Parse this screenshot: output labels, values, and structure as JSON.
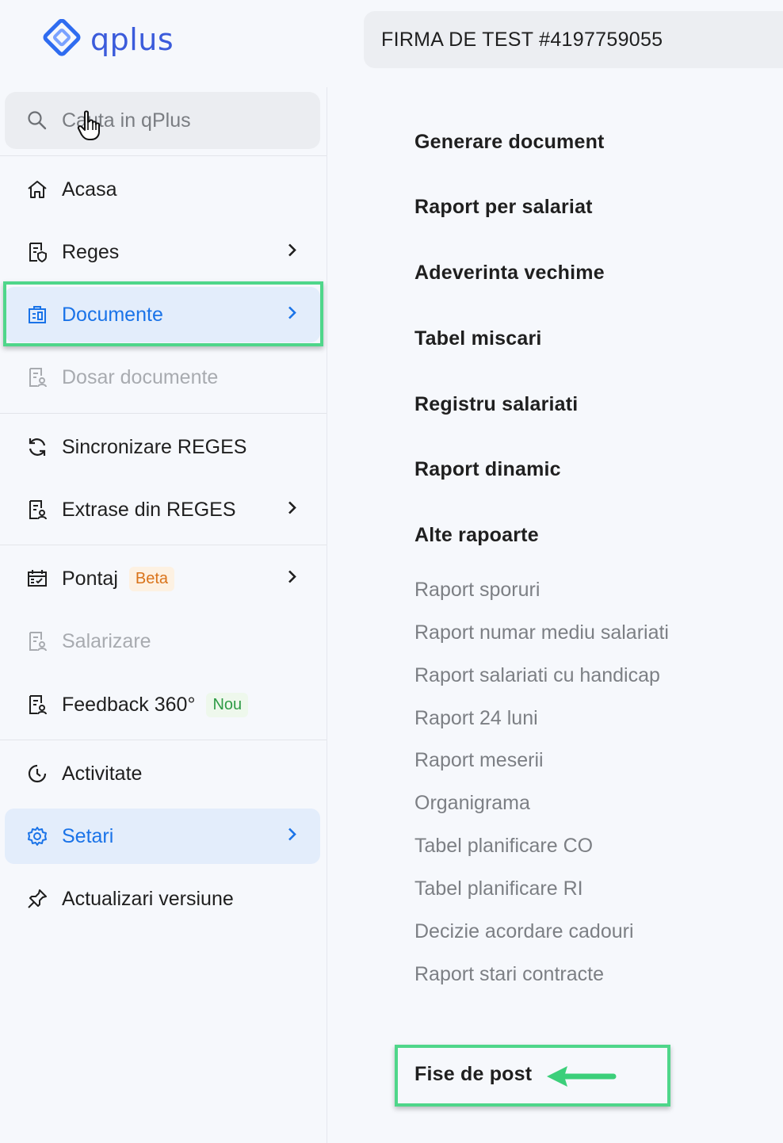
{
  "app": {
    "logo_text": "qplus"
  },
  "company": {
    "name": "FIRMA DE TEST #4197759055"
  },
  "search": {
    "placeholder": "Cauta in qPlus"
  },
  "sidebar": {
    "items": [
      {
        "label": "Acasa",
        "icon": "home-icon"
      },
      {
        "label": "Reges",
        "icon": "document-shield-icon"
      },
      {
        "label": "Documente",
        "icon": "documents-icon"
      },
      {
        "label": "Dosar documente",
        "icon": "folder-document-icon"
      },
      {
        "label": "Sincronizare REGES",
        "icon": "sync-icon"
      },
      {
        "label": "Extrase din REGES",
        "icon": "document-person-icon"
      },
      {
        "label": "Pontaj",
        "icon": "calendar-check-icon",
        "badge": "Beta"
      },
      {
        "label": "Salarizare",
        "icon": "payroll-icon"
      },
      {
        "label": "Feedback 360°",
        "icon": "feedback-icon",
        "badge": "Nou"
      },
      {
        "label": "Activitate",
        "icon": "history-icon"
      },
      {
        "label": "Setari",
        "icon": "gear-icon"
      },
      {
        "label": "Actualizari versiune",
        "icon": "pin-icon"
      }
    ]
  },
  "documents_menu": {
    "headers": [
      "Generare document",
      "Raport per salariat",
      "Adeverinta vechime",
      "Tabel miscari",
      "Registru salariati",
      "Raport dinamic",
      "Alte rapoarte"
    ],
    "other_reports": [
      "Raport sporuri",
      "Raport numar mediu salariati",
      "Raport salariati cu handicap",
      "Raport 24 luni",
      "Raport meserii",
      "Organigrama",
      "Tabel planificare CO",
      "Tabel planificare RI",
      "Decizie acordare cadouri",
      "Raport stari contracte"
    ],
    "job_descriptions": "Fise de post"
  },
  "colors": {
    "accent": "#1a73e8",
    "active_bg": "#e3edfb",
    "highlight": "#4fd68a",
    "beta": "#d9731a",
    "new": "#2e9b46"
  }
}
